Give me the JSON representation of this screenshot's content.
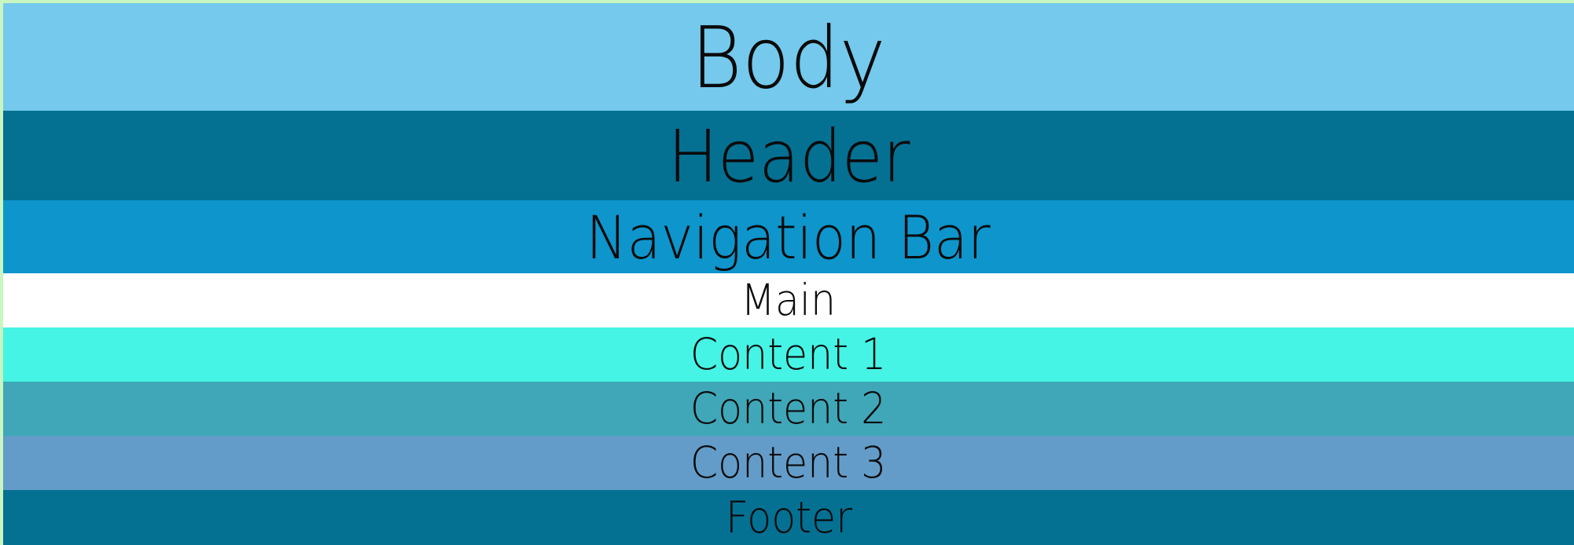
{
  "colors": {
    "page_border": "#c8f5c0",
    "body": "#74c9ed",
    "header": "#047092",
    "navigation_bar": "#0e95cb",
    "main": "#ffffff",
    "content_1": "#45f4e5",
    "content_2": "#3fa7b8",
    "content_3": "#639cc8",
    "footer": "#047092"
  },
  "layers": {
    "body": "Body",
    "header": "Header",
    "navigation_bar": "Navigation Bar",
    "main": "Main",
    "content_1": "Content 1",
    "content_2": "Content 2",
    "content_3": "Content 3",
    "footer": "Footer"
  }
}
